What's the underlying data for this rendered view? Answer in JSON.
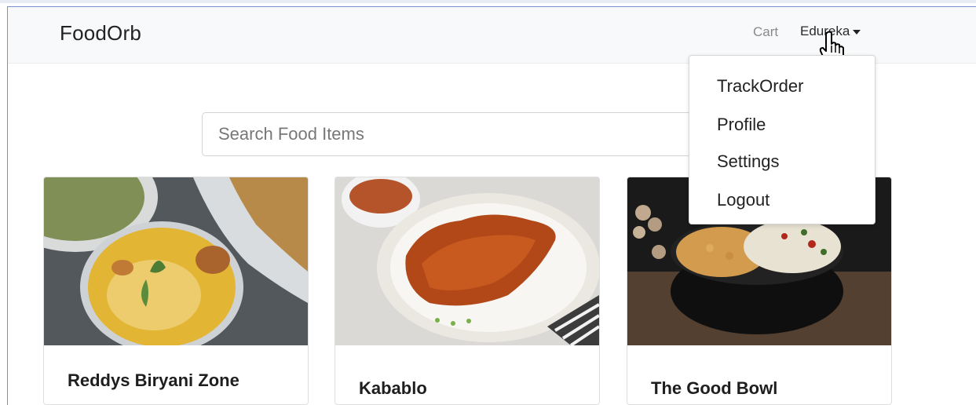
{
  "navbar": {
    "brand": "FoodOrb",
    "cart_label": "Cart",
    "user_label": "Edureka"
  },
  "dropdown": {
    "items": [
      "TrackOrder",
      "Profile",
      "Settings",
      "Logout"
    ]
  },
  "search": {
    "placeholder": "Search Food Items",
    "value": ""
  },
  "cards": [
    {
      "title": "Reddys Biryani Zone"
    },
    {
      "title": "Kabablo"
    },
    {
      "title": "The Good Bowl"
    }
  ],
  "colors": {
    "navbar_bg": "#f8f9fa",
    "frame_border": "#7a8fc9",
    "text": "#222222",
    "muted": "#8a8a8a"
  },
  "icons": {
    "user_menu": "caret-down-icon",
    "pointer": "hand-pointer-icon"
  }
}
